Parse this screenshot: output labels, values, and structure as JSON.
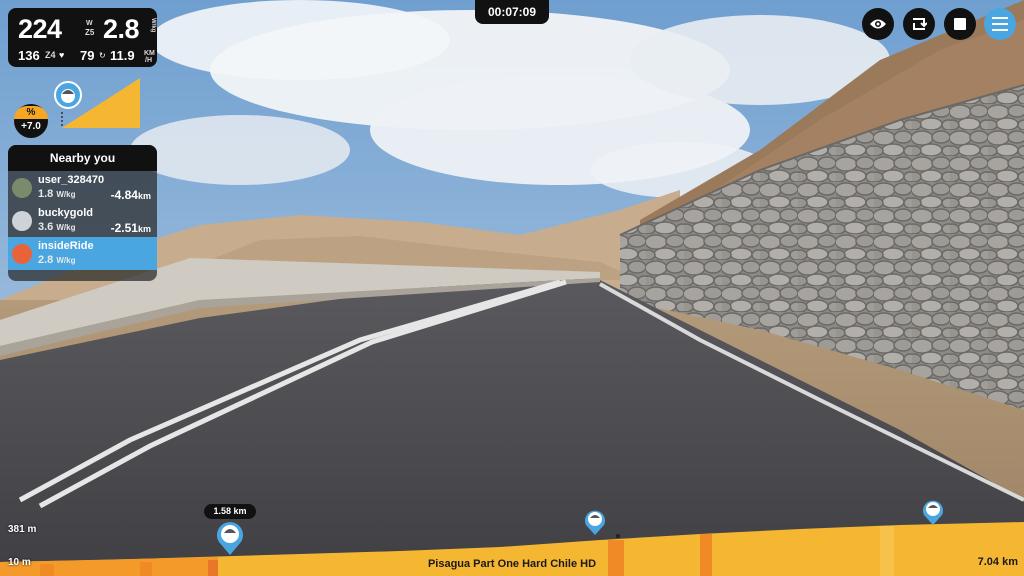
{
  "stats": {
    "power": "224",
    "power_unit": "W",
    "zone": "Z5",
    "wkg": "2.8",
    "wkg_unit": "W/kg",
    "heart_rate": "136",
    "hr_zone": "Z4",
    "cadence": "79",
    "speed": "11.9",
    "speed_unit_top": "KM",
    "speed_unit_bottom": "/H"
  },
  "timer": "00:07:09",
  "gradient": {
    "label": "%",
    "value": "+7.0"
  },
  "top_buttons": [
    "eye-icon",
    "repeat-icon",
    "stop-icon",
    "menu-icon"
  ],
  "nearby": {
    "title": "Nearby you",
    "riders": [
      {
        "name": "user_328470",
        "wkg": "1.8",
        "wkg_unit": "W/kg",
        "dist": "-4.84",
        "dist_unit": "km"
      },
      {
        "name": "buckygold",
        "wkg": "3.6",
        "wkg_unit": "W/kg",
        "dist": "-2.51",
        "dist_unit": "km"
      },
      {
        "name": "insideRide",
        "wkg": "2.8",
        "wkg_unit": "W/kg",
        "dist": "",
        "dist_unit": ""
      }
    ]
  },
  "elevation": {
    "max": "381 m",
    "min": "10 m",
    "route_name": "Pisagua Part One Hard Chile HD",
    "total_distance": "7.04 km",
    "current_marker": "1.58 km"
  },
  "colors": {
    "accent": "#4aa6e0",
    "panel": "#111111",
    "elevation": "#f5a623"
  }
}
